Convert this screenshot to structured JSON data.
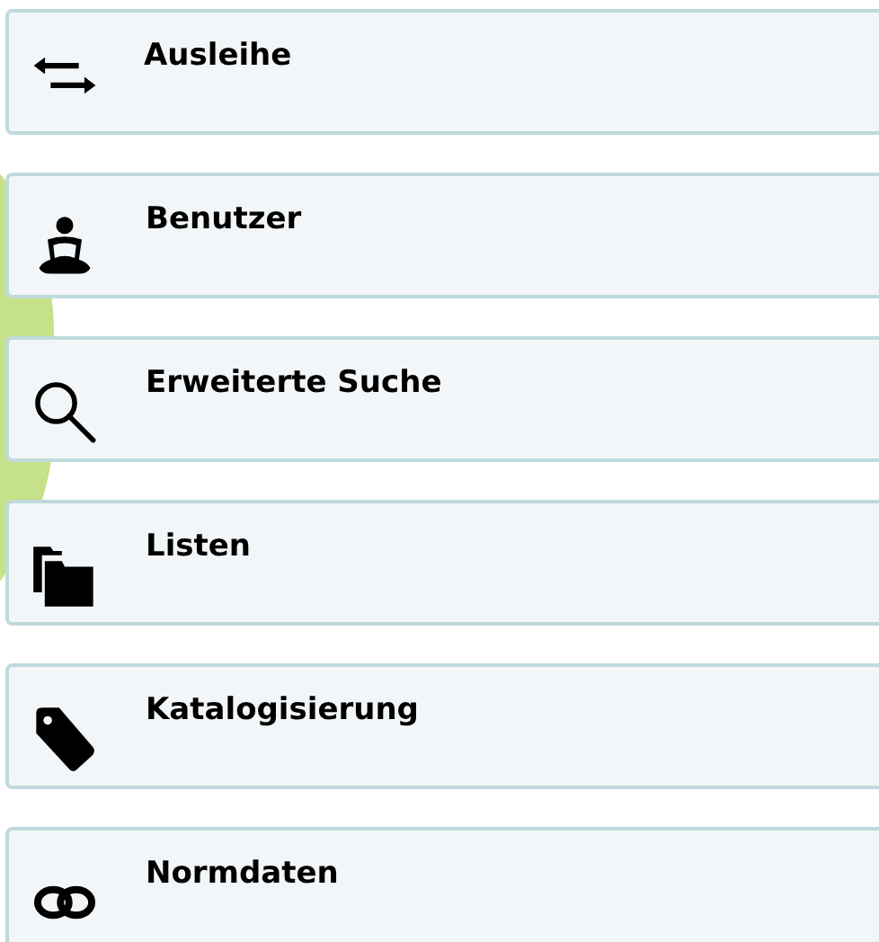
{
  "menu": [
    {
      "label": "Ausleihe",
      "kind": "circulation"
    },
    {
      "label": "Benutzer",
      "kind": "patrons"
    },
    {
      "label": "Erweiterte Suche",
      "kind": "search"
    },
    {
      "label": "Listen",
      "kind": "lists"
    },
    {
      "label": "Katalogisierung",
      "kind": "cataloging"
    },
    {
      "label": "Normdaten",
      "kind": "authorities"
    }
  ]
}
